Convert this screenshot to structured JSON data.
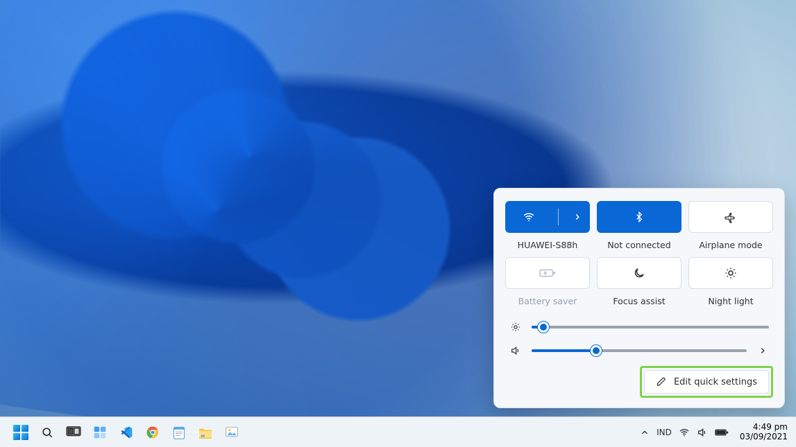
{
  "accent": "#0a68d6",
  "quick_settings": {
    "tiles": [
      {
        "id": "wifi",
        "label": "HUAWEI-S88h",
        "active": true,
        "expandable": true,
        "icon": "wifi-icon"
      },
      {
        "id": "bluetooth",
        "label": "Not connected",
        "active": true,
        "expandable": false,
        "icon": "bluetooth-icon"
      },
      {
        "id": "airplane",
        "label": "Airplane mode",
        "active": false,
        "expandable": false,
        "icon": "airplane-icon"
      },
      {
        "id": "battery",
        "label": "Battery saver",
        "active": false,
        "disabled": true,
        "icon": "battery-saver-icon"
      },
      {
        "id": "focus",
        "label": "Focus assist",
        "active": false,
        "expandable": false,
        "icon": "moon-icon"
      },
      {
        "id": "nightlight",
        "label": "Night light",
        "active": false,
        "expandable": false,
        "icon": "sun-icon"
      }
    ],
    "brightness": {
      "label": "Brightness",
      "value": 5
    },
    "volume": {
      "label": "Volume",
      "value": 30
    },
    "edit_label": "Edit quick settings"
  },
  "taskbar": {
    "pinned": [
      {
        "id": "start",
        "name": "start-button"
      },
      {
        "id": "search",
        "name": "search-icon"
      },
      {
        "id": "taskview",
        "name": "task-view-icon"
      },
      {
        "id": "widgets",
        "name": "widgets-icon"
      },
      {
        "id": "vscode",
        "name": "vscode-icon"
      },
      {
        "id": "chrome",
        "name": "chrome-icon"
      },
      {
        "id": "notepad",
        "name": "notepad-icon"
      },
      {
        "id": "explorer",
        "name": "file-explorer-icon"
      },
      {
        "id": "paint",
        "name": "paint-icon"
      }
    ],
    "tray": {
      "overflow": "show-hidden-icons",
      "ime": "IND",
      "icons": [
        "wifi",
        "volume",
        "battery"
      ],
      "time": "4:49 pm",
      "date": "03/09/2021"
    }
  }
}
